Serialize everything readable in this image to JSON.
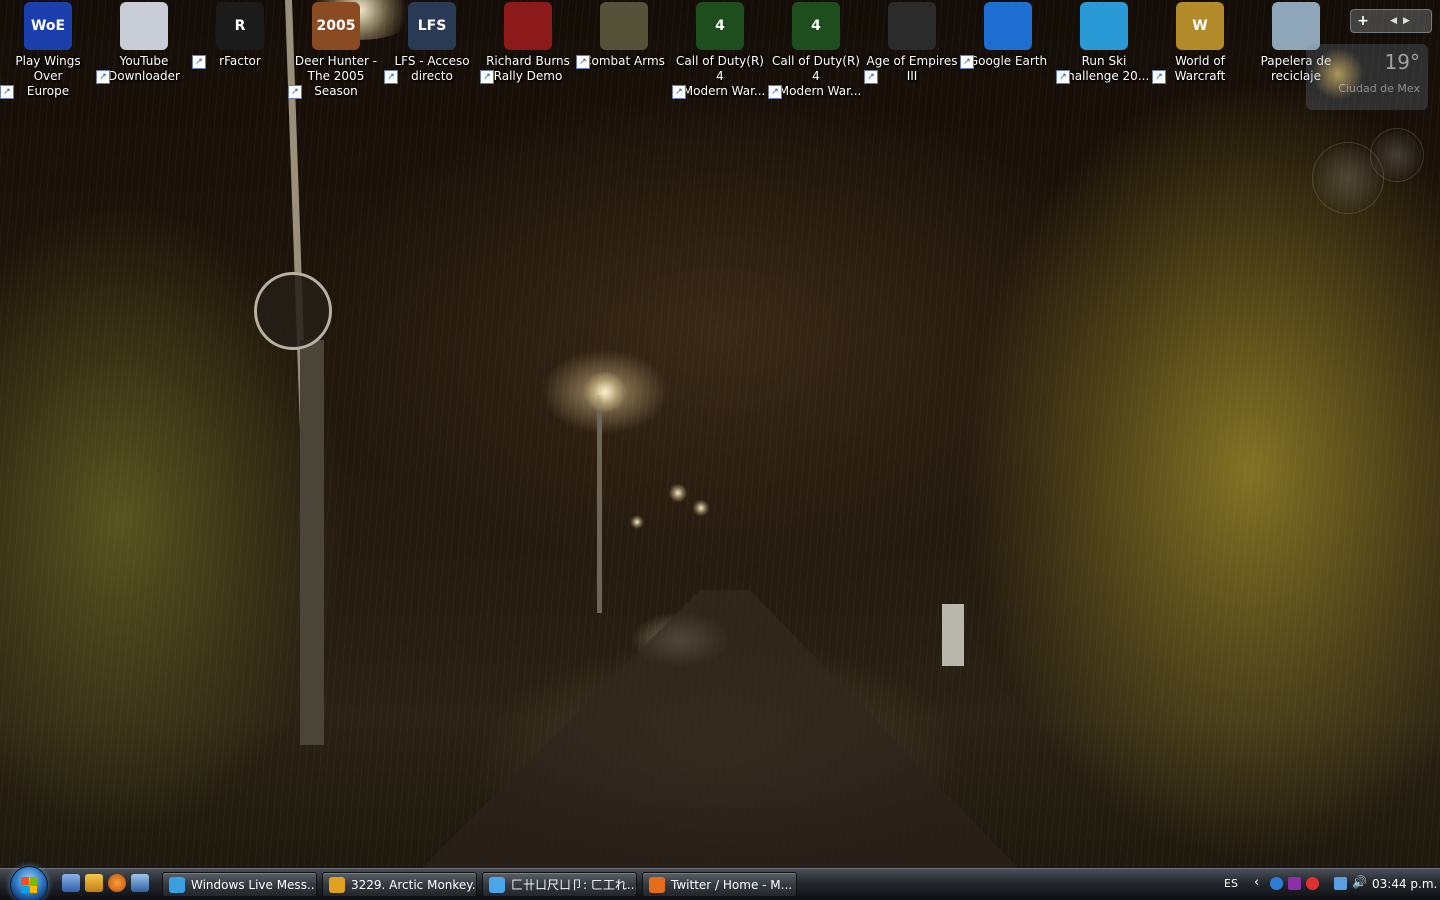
{
  "desktop": {
    "icons": [
      {
        "label": "Play Wings Over\nEurope",
        "icon": "woe-icon",
        "badge": "WoE",
        "color": "#1c3fae"
      },
      {
        "label": "YouTube\nDownloader",
        "icon": "youtube-downloader-icon",
        "badge": "",
        "color": "#c9ced6"
      },
      {
        "label": "rFactor",
        "icon": "rfactor-icon",
        "badge": "R",
        "color": "#1b1b1b"
      },
      {
        "label": "Deer Hunter -\nThe 2005 Season",
        "icon": "deer-hunter-icon",
        "badge": "2005",
        "color": "#8a4b22"
      },
      {
        "label": "LFS - Acceso\ndirecto",
        "icon": "lfs-icon",
        "badge": "LFS",
        "color": "#2a3a55"
      },
      {
        "label": "Richard Burns\nRally Demo",
        "icon": "rally-helmet-icon",
        "badge": "",
        "color": "#8d1a1a"
      },
      {
        "label": "Combat Arms",
        "icon": "combat-arms-icon",
        "badge": "",
        "color": "#55523a"
      },
      {
        "label": "Call of Duty(R) 4\n- Modern War...",
        "icon": "cod4-icon",
        "badge": "4",
        "color": "#1e4d1e"
      },
      {
        "label": "Call of Duty(R) 4\n- Modern War...",
        "icon": "cod4-icon",
        "badge": "4",
        "color": "#1e4d1e"
      },
      {
        "label": "Age of Empires III",
        "icon": "aoe3-icon",
        "badge": "",
        "color": "#2b2b2b"
      },
      {
        "label": "Google Earth",
        "icon": "google-earth-icon",
        "badge": "",
        "color": "#1e6fd1"
      },
      {
        "label": "Run Ski\nChallenge 20...",
        "icon": "ski-challenge-icon",
        "badge": "",
        "color": "#2a9ad6"
      },
      {
        "label": "World of\nWarcraft",
        "icon": "wow-icon",
        "badge": "W",
        "color": "#b38a2a"
      },
      {
        "label": "Papelera de\nreciclaje",
        "icon": "recycle-bin-icon",
        "badge": "",
        "color": "#8fa6b8"
      }
    ]
  },
  "sidebar": {
    "add_label": "+",
    "weather": {
      "temp": "19°",
      "location": "Ciudad de Mex"
    }
  },
  "taskbar": {
    "tasks": [
      {
        "label": "Windows Live Mess...",
        "icon": "messenger-icon",
        "color": "#3aa0e0"
      },
      {
        "label": "3229. Arctic Monkey...",
        "icon": "winamp-icon",
        "color": "#e0a020"
      },
      {
        "label": "匚卄ㄩ尺ㄩ卩: ㄈ工れ...",
        "icon": "messenger-chat-icon",
        "color": "#4aa6e8"
      },
      {
        "label": "Twitter / Home - M...",
        "icon": "firefox-icon",
        "color": "#e46d1c"
      }
    ],
    "tray": {
      "language": "ES",
      "clock": "03:44 p.m."
    }
  }
}
